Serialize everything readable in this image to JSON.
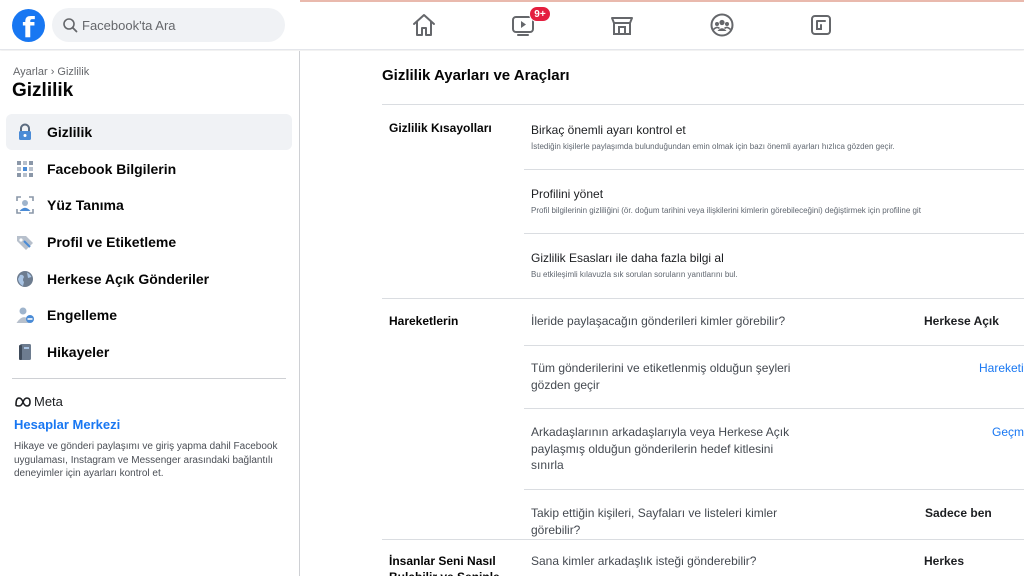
{
  "topbar": {
    "logo_letter": "f",
    "search_placeholder": "Facebook'ta Ara",
    "nav": [
      {
        "name": "home-icon"
      },
      {
        "name": "watch-icon",
        "badge": "9+"
      },
      {
        "name": "marketplace-icon"
      },
      {
        "name": "groups-icon"
      },
      {
        "name": "gaming-icon"
      }
    ],
    "colors": {
      "brand": "#1877f2",
      "badge": "#e41e3f"
    }
  },
  "sidebar": {
    "breadcrumb": "Ayarlar › Gizlilik",
    "title": "Gizlilik",
    "items": [
      {
        "label": "Gizlilik",
        "icon": "lock-icon",
        "active": true
      },
      {
        "label": "Facebook Bilgilerin",
        "icon": "grid-icon"
      },
      {
        "label": "Yüz Tanıma",
        "icon": "face-icon"
      },
      {
        "label": "Profil ve Etiketleme",
        "icon": "tag-icon"
      },
      {
        "label": "Herkese Açık Gönderiler",
        "icon": "globe-icon"
      },
      {
        "label": "Engelleme",
        "icon": "block-user-icon"
      },
      {
        "label": "Hikayeler",
        "icon": "book-icon"
      }
    ],
    "meta_label": "Meta",
    "accounts_center": "Hesaplar Merkezi",
    "accounts_desc": "Hikaye ve gönderi paylaşımı ve giriş yapma dahil Facebook uygulaması, Instagram ve Messenger arasındaki bağlantılı deneyimler için ayarları kontrol et."
  },
  "main": {
    "title": "Gizlilik Ayarları ve Araçları",
    "shortcuts": {
      "label": "Gizlilik Kısayolları",
      "rows": [
        {
          "title": "Birkaç önemli ayarı kontrol et",
          "desc": "İstediğin kişilerle paylaşımda bulunduğundan emin olmak için bazı önemli ayarları hızlıca gözden geçir."
        },
        {
          "title": "Profilini yönet",
          "desc": "Profil bilgilerinin gizliliğini (ör. doğum tarihini veya ilişkilerini kimlerin görebileceğini) değiştirmek için profiline git"
        },
        {
          "title": "Gizlilik Esasları ile daha fazla bilgi al",
          "desc": "Bu etkileşimli kılavuzla sık sorulan soruların yanıtlarını bul."
        }
      ]
    },
    "activity": {
      "label": "Hareketlerin",
      "rows": [
        {
          "question": "İleride paylaşacağın gönderileri kimler görebilir?",
          "value": "Herkese Açık"
        },
        {
          "question": "Tüm gönderilerini ve etiketlenmiş olduğun şeyleri gözden geçir",
          "link": "Hareketi"
        },
        {
          "question": "Arkadaşlarının arkadaşlarıyla veya Herkese Açık paylaşmış olduğun gönderilerin hedef kitlesini sınırla",
          "link": "Geçmi"
        },
        {
          "question": "Takip ettiğin kişileri, Sayfaları ve listeleri kimler görebilir?",
          "value": "Sadece ben"
        }
      ]
    },
    "find_you": {
      "label": "İnsanlar Seni Nasıl Bulabilir ve Seninle",
      "rows": [
        {
          "question": "Sana kimler arkadaşlık isteği gönderebilir?",
          "value": "Herkes"
        }
      ]
    }
  }
}
